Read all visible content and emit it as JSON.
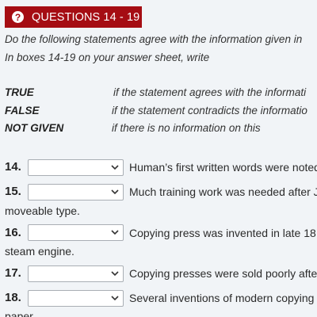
{
  "header": {
    "icon": "help-circle-icon",
    "title": "QUESTIONS 14 - 19",
    "accent_color": "#a50d13"
  },
  "instructions": {
    "line1": "Do the following statements agree with the information given in",
    "line2": "In boxes 14-19 on your answer sheet, write"
  },
  "legend": [
    {
      "key": "TRUE",
      "desc": "if the statement agrees with the informati"
    },
    {
      "key": "FALSE",
      "desc": "if the statement contradicts the informatio"
    },
    {
      "key": "NOT GIVEN",
      "desc": "if there is no information on this"
    }
  ],
  "questions": [
    {
      "number": "14.",
      "selected": "",
      "text": "Human’s first written words were noted",
      "continuation": ""
    },
    {
      "number": "15.",
      "selected": "",
      "text": "Much training work was needed after J",
      "continuation": "moveable type."
    },
    {
      "number": "16.",
      "selected": "",
      "text": "Copying press was invented in late 18",
      "continuation": "steam engine."
    },
    {
      "number": "17.",
      "selected": "",
      "text": "Copying presses were sold poorly afte",
      "continuation": ""
    },
    {
      "number": "18.",
      "selected": "",
      "text": "Several inventions of modern copying",
      "continuation": "paper"
    }
  ]
}
